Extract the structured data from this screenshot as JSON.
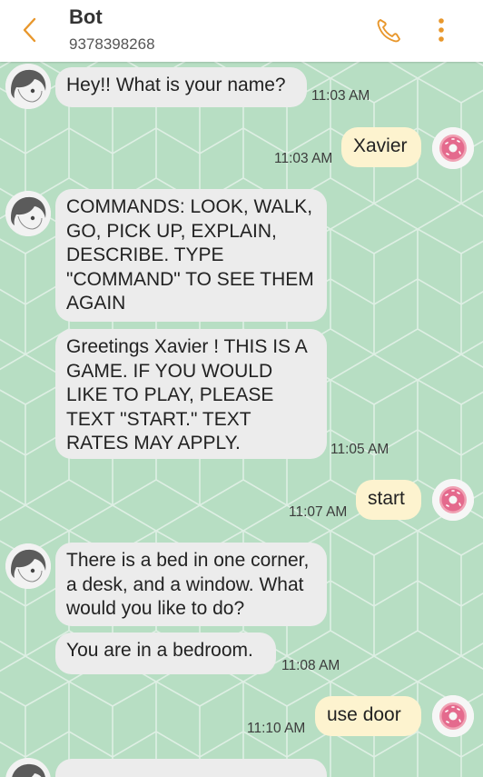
{
  "header": {
    "title": "Bot",
    "phone_number": "9378398268",
    "back_icon": "chevron-left-icon",
    "call_icon": "phone-icon",
    "more_icon": "more-vertical-icon",
    "accent_color": "#e8972c"
  },
  "chat": {
    "background_color": "#b7dec3",
    "incoming_bubble_color": "#ececec",
    "outgoing_bubble_color": "#fdf3cf",
    "messages": [
      {
        "from": "bot",
        "text": "Hey!! What is your name?",
        "time": "11:03 AM"
      },
      {
        "from": "me",
        "text": "Xavier",
        "time": "11:03 AM"
      },
      {
        "from": "bot",
        "text": "COMMANDS: LOOK, WALK, GO, PICK UP, EXPLAIN, DESCRIBE. TYPE \"COMMAND\" TO SEE THEM AGAIN"
      },
      {
        "from": "bot",
        "text": "Greetings Xavier ! THIS IS A GAME. IF YOU WOULD LIKE TO PLAY, PLEASE TEXT \"START.\" TEXT RATES MAY APPLY.",
        "time": "11:05 AM"
      },
      {
        "from": "me",
        "text": "start",
        "time": "11:07 AM"
      },
      {
        "from": "bot",
        "text": "There is a bed in one corner, a desk, and a window. What would you like to do?"
      },
      {
        "from": "bot",
        "text": "You are in a bedroom.",
        "time": "11:08 AM"
      },
      {
        "from": "me",
        "text": "use door",
        "time": "11:10 AM"
      }
    ]
  }
}
